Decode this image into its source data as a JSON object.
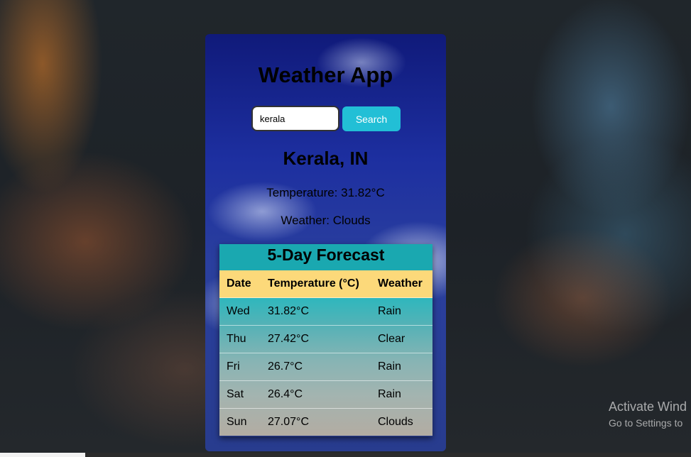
{
  "app": {
    "title": "Weather App"
  },
  "search": {
    "value": "kerala",
    "button_label": "Search"
  },
  "current": {
    "location": "Kerala, IN",
    "temperature_text": "Temperature: 31.82°C",
    "weather_text": "Weather: Clouds"
  },
  "forecast": {
    "title": "5-Day Forecast",
    "headers": [
      "Date",
      "Temperature (°C)",
      "Weather"
    ],
    "rows": [
      [
        "Wed",
        "31.82°C",
        "Rain"
      ],
      [
        "Thu",
        "27.42°C",
        "Clear"
      ],
      [
        "Fri",
        "26.7°C",
        "Rain"
      ],
      [
        "Sat",
        "26.4°C",
        "Rain"
      ],
      [
        "Sun",
        "27.07°C",
        "Clouds"
      ]
    ]
  },
  "os_watermark": {
    "title": "Activate Wind",
    "subtitle": "Go to Settings to"
  },
  "colors": {
    "search_button": "#22bfd6",
    "forecast_title_bg": "#1aa8b0",
    "table_header_bg": "#fcd97a"
  }
}
